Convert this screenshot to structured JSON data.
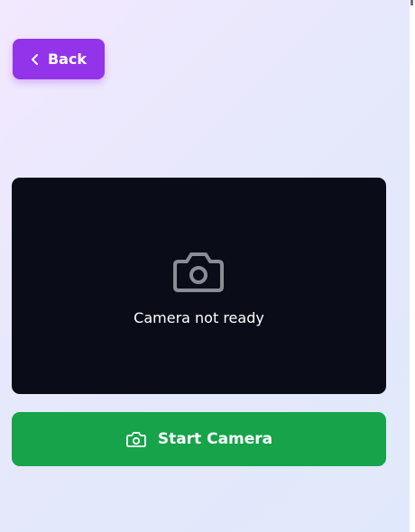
{
  "header": {
    "back_label": "Back"
  },
  "camera": {
    "status_text": "Camera not ready"
  },
  "actions": {
    "start_label": "Start Camera"
  },
  "icons": {
    "back": "chevron-left-icon",
    "camera_placeholder": "camera-icon",
    "start": "camera-icon"
  },
  "colors": {
    "back_button": "#9333ea",
    "start_button": "#16a34a",
    "camera_panel": "#0a0d17",
    "placeholder_icon": "#8a8d93"
  }
}
